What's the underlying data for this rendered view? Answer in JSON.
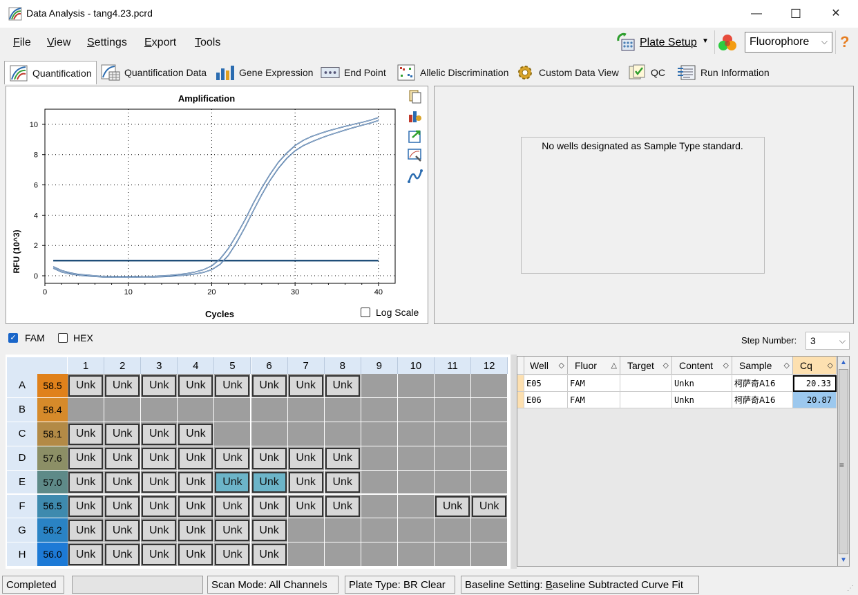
{
  "window": {
    "title": "Data Analysis - tang4.23.pcrd",
    "minimize": "—",
    "maximize": "☐",
    "close": "✕"
  },
  "menu": {
    "items": [
      {
        "label": "File",
        "accel": "F",
        "rest": "ile"
      },
      {
        "label": "View",
        "accel": "V",
        "rest": "iew"
      },
      {
        "label": "Settings",
        "accel": "S",
        "rest": "ettings"
      },
      {
        "label": "Export",
        "accel": "E",
        "rest": "xport"
      },
      {
        "label": "Tools",
        "accel": "T",
        "rest": "ools"
      }
    ],
    "plate_setup": "Plate Setup",
    "fluorophore": "Fluorophore",
    "help": "?"
  },
  "tabs": [
    {
      "label": "Quantification",
      "icon": "quantification-icon"
    },
    {
      "label": "Quantification Data",
      "icon": "quantification-data-icon"
    },
    {
      "label": "Gene Expression",
      "icon": "gene-expression-icon"
    },
    {
      "label": "End Point",
      "icon": "end-point-icon"
    },
    {
      "label": "Allelic Discrimination",
      "icon": "allelic-icon"
    },
    {
      "label": "Custom Data View",
      "icon": "gear-icon"
    },
    {
      "label": "QC",
      "icon": "qc-icon"
    },
    {
      "label": "Run Information",
      "icon": "run-info-icon"
    }
  ],
  "chart_data": {
    "type": "line",
    "title": "Amplification",
    "xlabel": "Cycles",
    "ylabel": "RFU (10^3)",
    "xlim": [
      0,
      42
    ],
    "ylim": [
      -0.5,
      11
    ],
    "xticks": [
      0,
      10,
      20,
      30,
      40
    ],
    "yticks": [
      0,
      2,
      4,
      6,
      8,
      10
    ],
    "grid": true,
    "threshold": 1.0,
    "series": [
      {
        "values": [
          [
            1,
            0.6
          ],
          [
            2,
            0.35
          ],
          [
            3,
            0.2
          ],
          [
            4,
            0.1
          ],
          [
            5,
            0.05
          ],
          [
            6,
            0.0
          ],
          [
            7,
            -0.05
          ],
          [
            8,
            -0.07
          ],
          [
            9,
            -0.08
          ],
          [
            10,
            -0.08
          ],
          [
            11,
            -0.07
          ],
          [
            12,
            -0.06
          ],
          [
            13,
            -0.04
          ],
          [
            14,
            0.0
          ],
          [
            15,
            0.03
          ],
          [
            16,
            0.08
          ],
          [
            17,
            0.15
          ],
          [
            18,
            0.25
          ],
          [
            19,
            0.4
          ],
          [
            20,
            0.65
          ],
          [
            21,
            1.1
          ],
          [
            22,
            1.8
          ],
          [
            23,
            2.7
          ],
          [
            24,
            3.7
          ],
          [
            25,
            4.8
          ],
          [
            26,
            5.8
          ],
          [
            27,
            6.7
          ],
          [
            28,
            7.5
          ],
          [
            29,
            8.1
          ],
          [
            30,
            8.6
          ],
          [
            31,
            8.95
          ],
          [
            32,
            9.2
          ],
          [
            33,
            9.4
          ],
          [
            34,
            9.57
          ],
          [
            35,
            9.72
          ],
          [
            36,
            9.87
          ],
          [
            37,
            10.0
          ],
          [
            38,
            10.13
          ],
          [
            39,
            10.27
          ],
          [
            40,
            10.45
          ]
        ]
      },
      {
        "values": [
          [
            1,
            0.5
          ],
          [
            2,
            0.25
          ],
          [
            3,
            0.12
          ],
          [
            4,
            0.04
          ],
          [
            5,
            -0.01
          ],
          [
            6,
            -0.05
          ],
          [
            7,
            -0.08
          ],
          [
            8,
            -0.1
          ],
          [
            9,
            -0.1
          ],
          [
            10,
            -0.1
          ],
          [
            11,
            -0.1
          ],
          [
            12,
            -0.09
          ],
          [
            13,
            -0.08
          ],
          [
            14,
            -0.06
          ],
          [
            15,
            -0.04
          ],
          [
            16,
            0.0
          ],
          [
            17,
            0.05
          ],
          [
            18,
            0.12
          ],
          [
            19,
            0.22
          ],
          [
            20,
            0.4
          ],
          [
            21,
            0.75
          ],
          [
            22,
            1.35
          ],
          [
            23,
            2.2
          ],
          [
            24,
            3.2
          ],
          [
            25,
            4.3
          ],
          [
            26,
            5.35
          ],
          [
            27,
            6.3
          ],
          [
            28,
            7.1
          ],
          [
            29,
            7.75
          ],
          [
            30,
            8.25
          ],
          [
            31,
            8.6
          ],
          [
            32,
            8.85
          ],
          [
            33,
            9.07
          ],
          [
            34,
            9.27
          ],
          [
            35,
            9.45
          ],
          [
            36,
            9.62
          ],
          [
            37,
            9.78
          ],
          [
            38,
            9.93
          ],
          [
            39,
            10.08
          ],
          [
            40,
            10.25
          ]
        ]
      }
    ]
  },
  "log_scale_label": "Log Scale",
  "std_message": "No wells designated as Sample Type standard.",
  "fluor_checks": [
    {
      "label": "FAM",
      "checked": true
    },
    {
      "label": "HEX",
      "checked": false
    }
  ],
  "step_number_label": "Step Number:",
  "step_number_value": "3",
  "plate": {
    "columns": [
      "1",
      "2",
      "3",
      "4",
      "5",
      "6",
      "7",
      "8",
      "9",
      "10",
      "11",
      "12"
    ],
    "rows": [
      {
        "label": "A",
        "temp": "58.5",
        "color": "#e0811b",
        "wells": [
          1,
          2,
          3,
          4,
          5,
          6,
          7,
          8
        ]
      },
      {
        "label": "B",
        "temp": "58.4",
        "color": "#d68a2a",
        "wells": []
      },
      {
        "label": "C",
        "temp": "58.1",
        "color": "#b38a46",
        "wells": [
          1,
          2,
          3,
          4
        ]
      },
      {
        "label": "D",
        "temp": "57.6",
        "color": "#8c8f66",
        "wells": [
          1,
          2,
          3,
          4,
          5,
          6,
          7,
          8
        ]
      },
      {
        "label": "E",
        "temp": "57.0",
        "color": "#5e8a88",
        "wells": [
          1,
          2,
          3,
          4,
          5,
          6,
          7,
          8
        ]
      },
      {
        "label": "F",
        "temp": "56.5",
        "color": "#3e8aae",
        "wells": [
          1,
          2,
          3,
          4,
          5,
          6,
          7,
          8,
          11,
          12
        ]
      },
      {
        "label": "G",
        "temp": "56.2",
        "color": "#2a83c4",
        "wells": [
          1,
          2,
          3,
          4,
          5,
          6
        ]
      },
      {
        "label": "H",
        "temp": "56.0",
        "color": "#1d7ad6",
        "wells": [
          1,
          2,
          3,
          4,
          5,
          6
        ]
      }
    ],
    "well_label": "Unk",
    "selected": [
      "E5",
      "E6"
    ]
  },
  "results": {
    "headers": [
      "Well",
      "Fluor",
      "Target",
      "Content",
      "Sample",
      "Cq"
    ],
    "rows": [
      [
        "E05",
        "FAM",
        "",
        "Unkn",
        "柯萨奇A16",
        "20.33"
      ],
      [
        "E06",
        "FAM",
        "",
        "Unkn",
        "柯萨奇A16",
        "20.87"
      ]
    ]
  },
  "status": {
    "state": "Completed",
    "scan_mode": "Scan Mode: All Channels",
    "plate_type": "Plate Type: BR Clear",
    "baseline_prefix": "Baseline Setting: ",
    "baseline_accel": "B",
    "baseline_rest": "aseline Subtracted Curve Fit"
  }
}
